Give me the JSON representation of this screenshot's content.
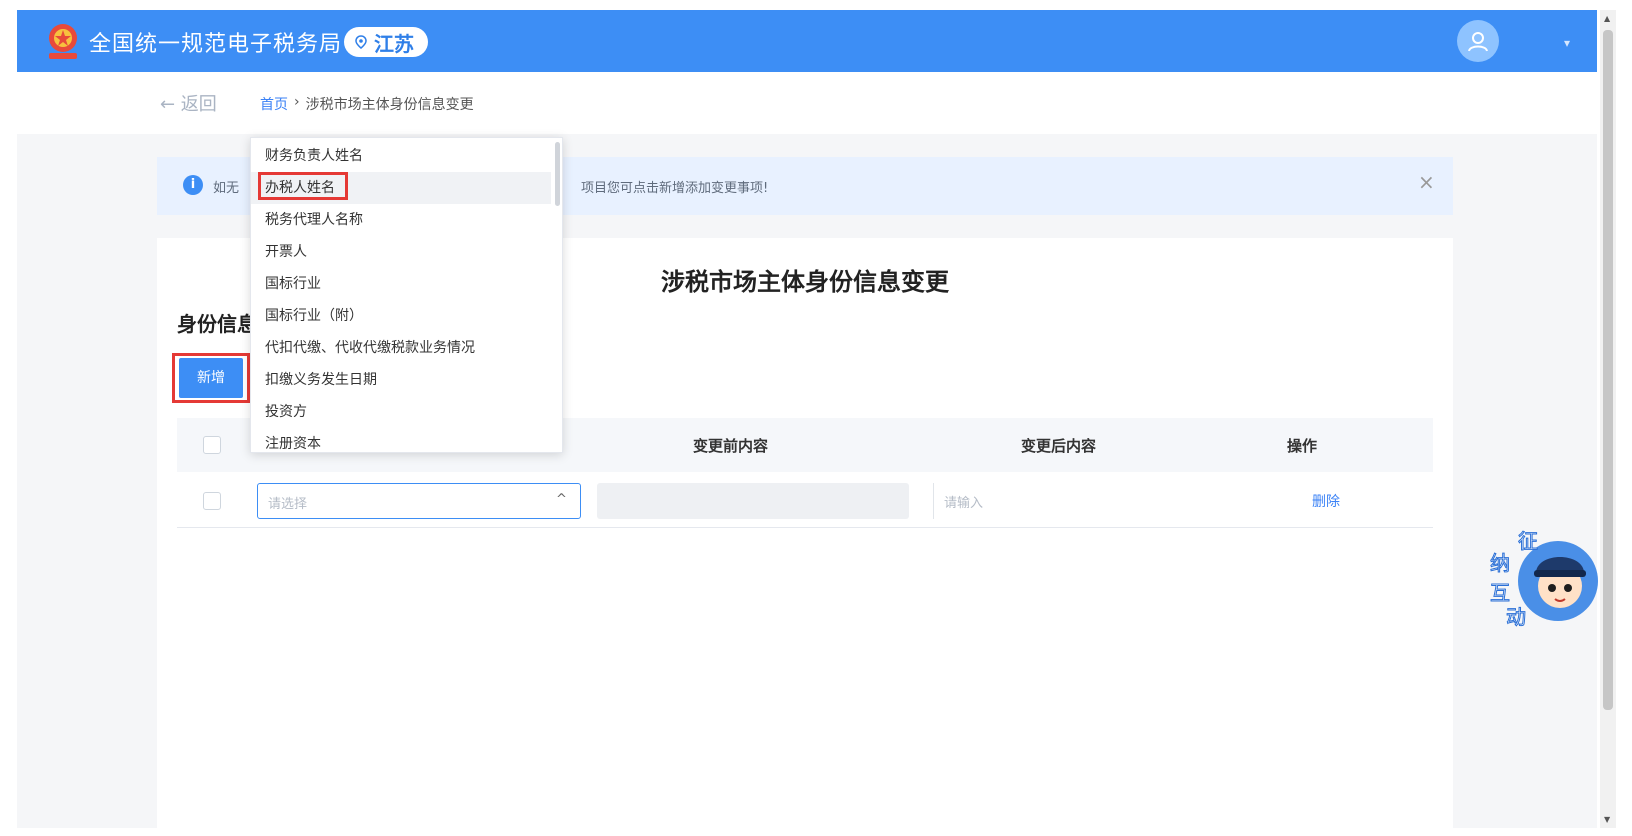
{
  "header": {
    "site_title": "全国统一规范电子税务局",
    "region": "江苏"
  },
  "breadcrumb": {
    "back_label": "← 返回",
    "home": "首页",
    "separator": "›",
    "current": "涉税市场主体身份信息变更"
  },
  "notice": {
    "prefix": "如无",
    "text": "项目您可点击新增添加变更事项!",
    "close": "×"
  },
  "form": {
    "title": "涉税市场主体身份信息变更",
    "section_title": "身份信息",
    "add_button": "新增",
    "columns": [
      "变更前内容",
      "变更后内容",
      "操作"
    ],
    "row": {
      "select_placeholder": "请选择",
      "after_placeholder": "请输入",
      "delete_label": "删除"
    }
  },
  "dropdown": {
    "items": [
      "财务负责人姓名",
      "办税人姓名",
      "税务代理人名称",
      "开票人",
      "国标行业",
      "国标行业（附）",
      "代扣代缴、代收代缴税款业务情况",
      "扣缴义务发生日期",
      "投资方",
      "注册资本"
    ],
    "highlighted_index": 1
  },
  "assistant": {
    "chars": [
      "征",
      "纳",
      "互",
      "动"
    ]
  },
  "colors": {
    "brand_blue": "#3d8ef5",
    "highlight_red": "#e53935"
  }
}
